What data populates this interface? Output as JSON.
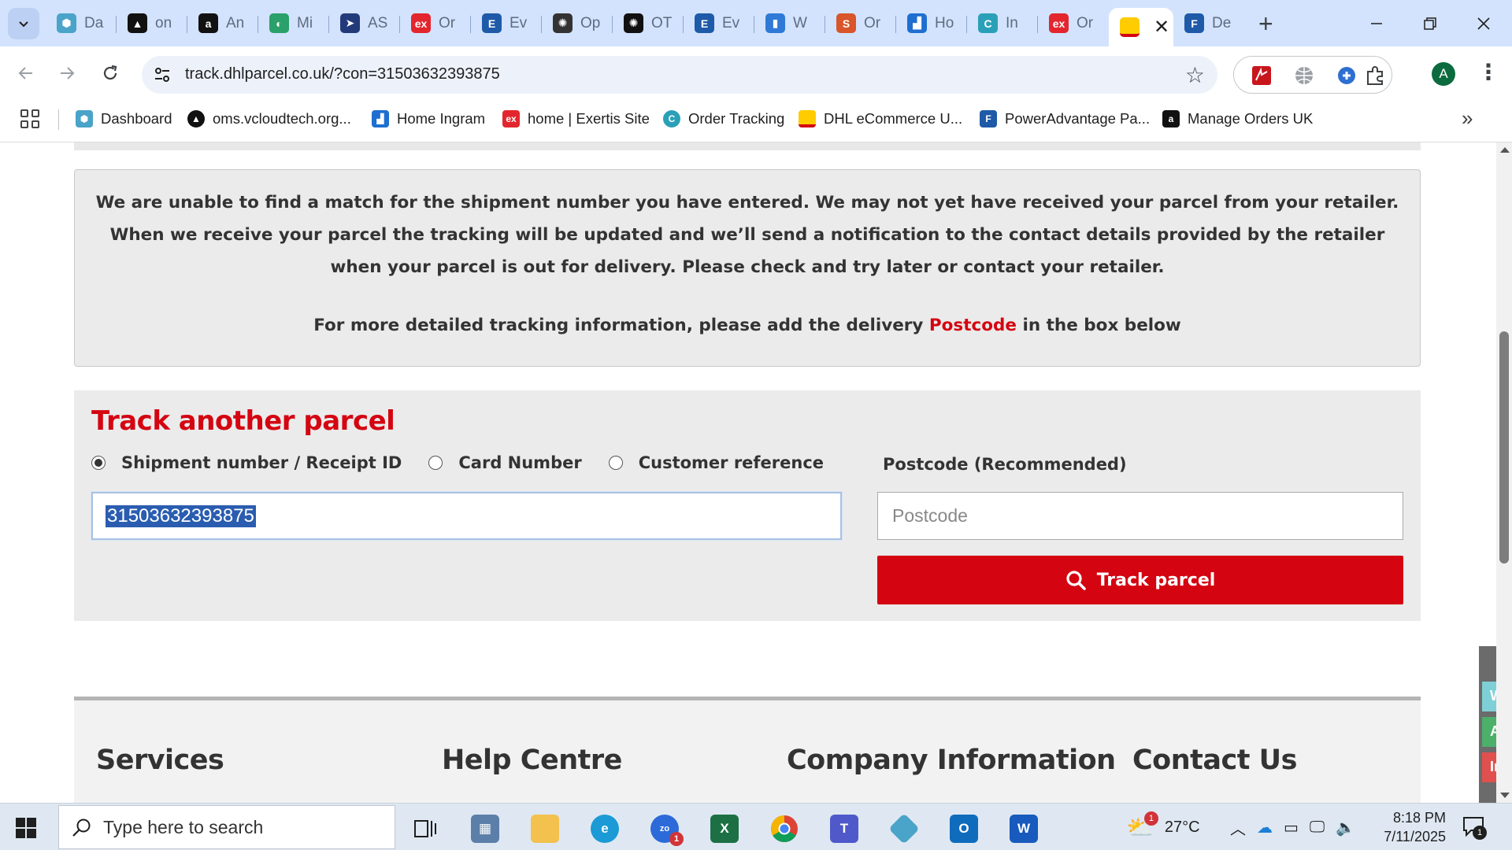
{
  "browser": {
    "tabs": [
      {
        "title": "Da",
        "icon": "dashboard-hex-icon",
        "color": "#4aa3c9"
      },
      {
        "title": "on",
        "icon": "vcloud-icon",
        "color": "#111111"
      },
      {
        "title": "An",
        "icon": "amazon-icon",
        "color": "#111111"
      },
      {
        "title": "Mi",
        "icon": "mi-icon",
        "color": "#2aa06a"
      },
      {
        "title": "AS",
        "icon": "arrow-icon",
        "color": "#233a7a"
      },
      {
        "title": "Or",
        "icon": "exertis-icon",
        "color": "#e3262e"
      },
      {
        "title": "Ev",
        "icon": "e-icon",
        "color": "#1e5aa8"
      },
      {
        "title": "Op",
        "icon": "openai-icon",
        "color": "#333333"
      },
      {
        "title": "OT",
        "icon": "openai-dark-icon",
        "color": "#111111"
      },
      {
        "title": "Ev",
        "icon": "e-icon",
        "color": "#1e5aa8"
      },
      {
        "title": "W",
        "icon": "chart-icon",
        "color": "#2f7ad6"
      },
      {
        "title": "Or",
        "icon": "s-logo-icon",
        "color": "#d9552a"
      },
      {
        "title": "Ho",
        "icon": "ingram-icon",
        "color": "#1e6fd0"
      },
      {
        "title": "In",
        "icon": "c-icon",
        "color": "#2aa0b8"
      },
      {
        "title": "Or",
        "icon": "exertis-icon",
        "color": "#e3262e"
      },
      {
        "title": "",
        "icon": "dhl-icon",
        "color": "#ffcc00",
        "active": true
      },
      {
        "title": "De",
        "icon": "doc-icon",
        "color": "#1e5aa8"
      }
    ],
    "url": "track.dhlparcel.co.uk/?con=31503632393875",
    "avatar_letter": "A",
    "bookmarks": [
      {
        "label": "Dashboard",
        "icon": "dashboard-hex-icon",
        "color": "#4aa3c9"
      },
      {
        "label": "oms.vcloudtech.org...",
        "icon": "vcloud-icon",
        "color": "#111111"
      },
      {
        "label": "Home Ingram",
        "icon": "ingram-icon",
        "color": "#1e6fd0"
      },
      {
        "label": "home | Exertis Site",
        "icon": "exertis-icon",
        "color": "#e3262e"
      },
      {
        "label": "Order Tracking",
        "icon": "c-icon",
        "color": "#2aa0b8"
      },
      {
        "label": "DHL eCommerce U...",
        "icon": "dhl-icon",
        "color": "#ffcc00"
      },
      {
        "label": "PowerAdvantage Pa...",
        "icon": "doc-icon",
        "color": "#1e5aa8"
      },
      {
        "label": "Manage Orders UK",
        "icon": "amazon-icon",
        "color": "#111111"
      }
    ]
  },
  "page": {
    "notice_line1": "We are unable to find a match for the shipment number you have entered. We may not yet have received your parcel from your retailer. When we receive your parcel the tracking will be updated and we’ll send a notification to the contact details provided by the retailer when your parcel is out for delivery. Please check and try later or contact your retailer.",
    "postcode_prefix": "For more detailed tracking information, please add the delivery ",
    "postcode_word": "Postcode",
    "postcode_suffix": " in the box below",
    "track_title": "Track another parcel",
    "radio_options": [
      "Shipment number / Receipt ID",
      "Card Number",
      "Customer reference"
    ],
    "selected_option": "Shipment number / Receipt ID",
    "shipment_value": "31503632393875",
    "postcode_label": "Postcode (Recommended)",
    "postcode_placeholder": "Postcode",
    "track_button": "Track parcel",
    "footer_headings": [
      "Services",
      "Help Centre",
      "Company Information",
      "Contact Us"
    ],
    "side_tabs": [
      {
        "label": "We",
        "color": "#7fd0d6"
      },
      {
        "label": "Ac",
        "color": "#4caf6a"
      },
      {
        "label": "In",
        "color": "#e0504f"
      }
    ],
    "brand_red": "#d40511"
  },
  "taskbar": {
    "search_placeholder": "Type here to search",
    "weather": "27°C",
    "weather_badge": "1",
    "time": "8:18 PM",
    "date": "7/11/2025",
    "notification_count": "1",
    "zoom_badge": "1"
  }
}
